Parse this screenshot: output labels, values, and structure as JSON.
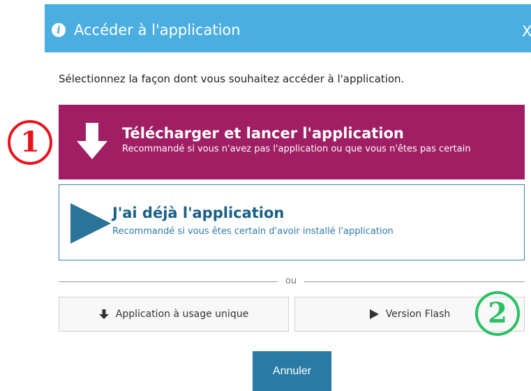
{
  "dialog": {
    "title": "Accéder à l'application",
    "close_label": "X",
    "intro": "Sélectionnez la façon dont vous souhaitez accéder à l'application."
  },
  "options": {
    "download": {
      "title": "Télécharger et lancer l'application",
      "subtitle": "Recommandé si vous n'avez pas l'application ou que vous n'êtes pas certain",
      "icon": "arrow-down-icon",
      "color": "#a01e64"
    },
    "have_app": {
      "title": "J'ai déjà l'application",
      "subtitle": "Recommandé si vous êtes certain d'avoir installé l'application",
      "icon": "play-icon",
      "color": "#1c6a92"
    }
  },
  "divider_label": "ou",
  "secondary": {
    "single_use": "Application à usage unique",
    "flash": "Version Flash"
  },
  "annotations": {
    "one": "①",
    "two": "2"
  },
  "cancel_label": "Annuler",
  "colors": {
    "header": "#4baee0",
    "primary_button": "#2b7aa6",
    "annotation_red": "#e8141d",
    "annotation_green": "#2bc063"
  }
}
